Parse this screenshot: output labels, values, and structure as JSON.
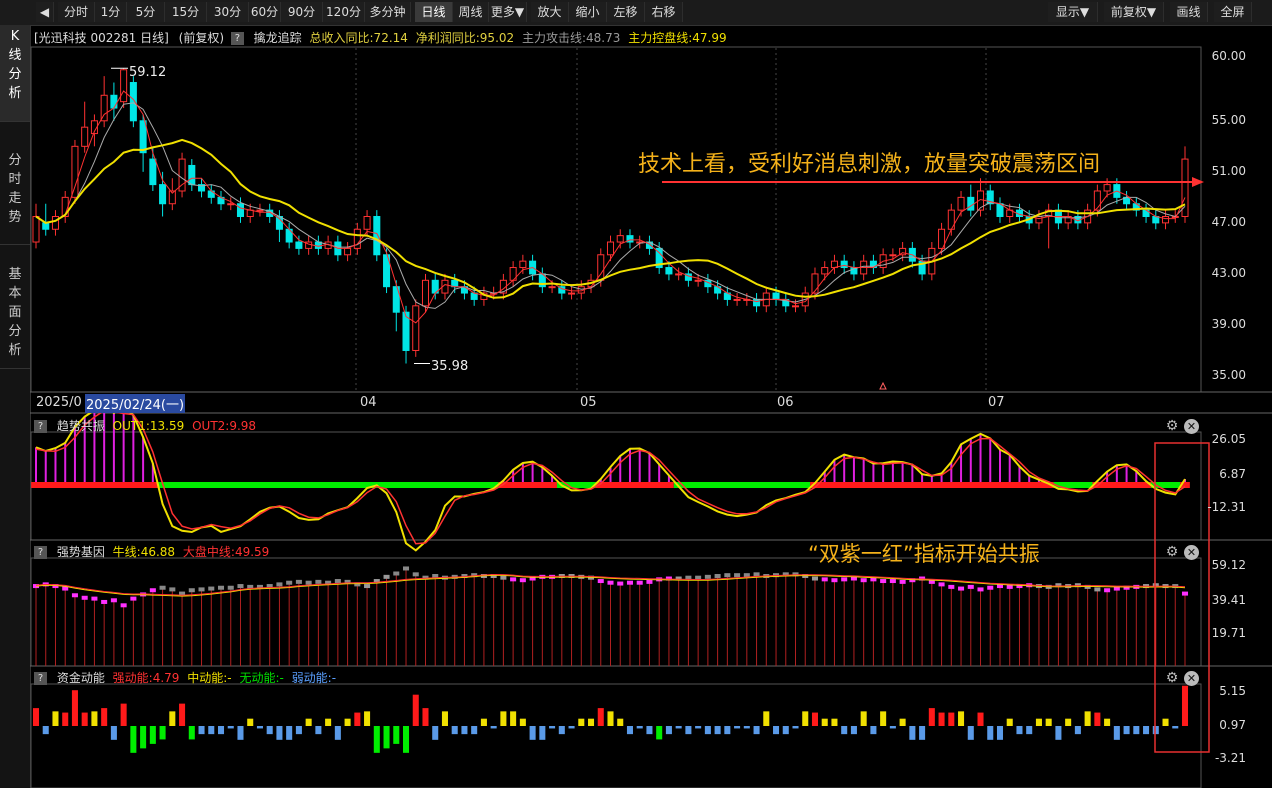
{
  "toolbar": {
    "items": [
      "分时",
      "1分",
      "5分",
      "15分",
      "30分",
      "60分",
      "90分",
      "120分",
      "多分钟",
      "日线",
      "周线",
      "更多▼",
      "放大",
      "缩小",
      "左移",
      "右移"
    ],
    "active": "日线",
    "right_items": [
      "显示▼",
      "前复权▼",
      "画线",
      "全屏"
    ]
  },
  "sidebar": {
    "tabs": [
      {
        "label": "K线分析",
        "active": true
      },
      {
        "label": "分时走势",
        "active": false
      },
      {
        "label": "基本面分析",
        "active": false
      }
    ]
  },
  "main_panel": {
    "title": "[光迅科技 002281 日线]",
    "adjust": "(前复权)",
    "indicator_name": "擒龙追踪",
    "metrics": [
      {
        "label": "总收入同比:72.14",
        "color": "#e0d040"
      },
      {
        "label": "净利润同比:95.02",
        "color": "#e0d040"
      },
      {
        "label": "主力攻击线:48.73",
        "color": "#9a9a9a"
      },
      {
        "label": "主力控盘线:47.99",
        "color": "#f0e000"
      }
    ],
    "y_ticks": [
      "60.00",
      "55.00",
      "51.00",
      "47.00",
      "43.00",
      "39.00",
      "35.00"
    ],
    "high_label": "59.12",
    "low_label": "35.98",
    "annotation": "技术上看，受利好消息刺激，放量突破震荡区间"
  },
  "date_axis": {
    "start": "2025/0",
    "cursor": "2025/02/24(一)",
    "months": [
      "04",
      "05",
      "06",
      "07"
    ]
  },
  "trend_panel": {
    "name": "趋势共振",
    "out1": "OUT1:13.59",
    "out2": "OUT2:9.98",
    "y_ticks": [
      "26.05",
      "6.87",
      "-12.31"
    ]
  },
  "gene_panel": {
    "name": "强势基因",
    "niu": "牛线:46.88",
    "dapan": "大盘中线:49.59",
    "y_ticks": [
      "59.12",
      "39.41",
      "19.71"
    ],
    "annotation": "“双紫一红”指标开始共振"
  },
  "fund_panel": {
    "name": "资金动能",
    "strong": "强动能:4.79",
    "mid": "中动能:-",
    "none": "无动能:-",
    "weak": "弱动能:-",
    "y_ticks": [
      "5.15",
      "0.97",
      "-3.21"
    ]
  },
  "colors": {
    "up": "#ff3232",
    "down": "#00e6e6",
    "ma_fast": "#ff3232",
    "ma_gray": "#aaaaaa",
    "ma_slow": "#f0e000",
    "purple": "#e020e0",
    "green": "#00ff00",
    "annotation": "#f5b21a"
  },
  "chart_data": [
    {
      "type": "candlestick",
      "title": "[光迅科技 002281 日线]",
      "ylim": [
        35,
        60
      ],
      "y_ticks": [
        60,
        55,
        51,
        47,
        43,
        39,
        35
      ],
      "note": "daily candles, approx O,C,H,L",
      "candles": [
        [
          45.5,
          47.5,
          48.5,
          45
        ],
        [
          47,
          46.5,
          48.5,
          46
        ],
        [
          46.5,
          47.5,
          48,
          46
        ],
        [
          47.5,
          49,
          49.5,
          47
        ],
        [
          49,
          53,
          53.5,
          48.5
        ],
        [
          53,
          54.5,
          56.5,
          52.5
        ],
        [
          54,
          55,
          55.5,
          53
        ],
        [
          55,
          57,
          58.5,
          54.5
        ],
        [
          57,
          56,
          58,
          55
        ],
        [
          56.5,
          59,
          59.12,
          56
        ],
        [
          58,
          55,
          58.5,
          54.5
        ],
        [
          55,
          52.5,
          55.5,
          51
        ],
        [
          52,
          50,
          53,
          49.5
        ],
        [
          50,
          48.5,
          51,
          47.5
        ],
        [
          48.5,
          49.5,
          50.5,
          48
        ],
        [
          49.5,
          52,
          52.5,
          49
        ],
        [
          51.5,
          50,
          52,
          49.5
        ],
        [
          50,
          49.5,
          50.5,
          49
        ],
        [
          49.5,
          49,
          50,
          48.5
        ],
        [
          49,
          48.5,
          49.5,
          48
        ],
        [
          48.5,
          48.5,
          49,
          48
        ],
        [
          48.5,
          47.5,
          49,
          47
        ],
        [
          47.5,
          48,
          48.5,
          47
        ],
        [
          48,
          48,
          48.5,
          47.5
        ],
        [
          48,
          47.5,
          48.5,
          47
        ],
        [
          47.5,
          46.5,
          48,
          45.5
        ],
        [
          46.5,
          45.5,
          47,
          45
        ],
        [
          45.5,
          45,
          46,
          44.5
        ],
        [
          45,
          45.5,
          46,
          44.5
        ],
        [
          45.5,
          45,
          46,
          44.5
        ],
        [
          45,
          45.5,
          46,
          44.5
        ],
        [
          45.5,
          44.5,
          46,
          44
        ],
        [
          44.5,
          45,
          45.5,
          44
        ],
        [
          45,
          46.5,
          47,
          44.5
        ],
        [
          46.5,
          47.5,
          48,
          46
        ],
        [
          47.5,
          44.5,
          48,
          44
        ],
        [
          44.5,
          42,
          45,
          41.5
        ],
        [
          42,
          40,
          42.5,
          38.5
        ],
        [
          40,
          37,
          40.5,
          35.98
        ],
        [
          37,
          40.5,
          41,
          36.5
        ],
        [
          40.5,
          42.5,
          43,
          40
        ],
        [
          42.5,
          41.5,
          43,
          41
        ],
        [
          41.5,
          42.5,
          43,
          41
        ],
        [
          42.5,
          42,
          43,
          41.5
        ],
        [
          42,
          41.5,
          42.5,
          41
        ],
        [
          41.5,
          41,
          42,
          40.5
        ],
        [
          41,
          41.5,
          42,
          40.5
        ],
        [
          41.5,
          41.5,
          42,
          41
        ],
        [
          41.5,
          42.5,
          43,
          41
        ],
        [
          42.5,
          43.5,
          44,
          42
        ],
        [
          43.5,
          44,
          44.5,
          43
        ],
        [
          44,
          43,
          44.5,
          42.5
        ],
        [
          43,
          42,
          43.5,
          41.5
        ],
        [
          42,
          42,
          42.5,
          41.5
        ],
        [
          42,
          41.5,
          42.5,
          41
        ],
        [
          41.5,
          41.5,
          42,
          41
        ],
        [
          41.5,
          42,
          42.5,
          41
        ],
        [
          42,
          42.5,
          43,
          41.5
        ],
        [
          42.5,
          44.5,
          45,
          42
        ],
        [
          44.5,
          45.5,
          46,
          44
        ],
        [
          45.5,
          46,
          46.5,
          45
        ],
        [
          46,
          45.5,
          46.5,
          45
        ],
        [
          45.5,
          45.5,
          46,
          45
        ],
        [
          45.5,
          45,
          46,
          44.5
        ],
        [
          45,
          43.5,
          45.5,
          43
        ],
        [
          43.5,
          43,
          44,
          42.5
        ],
        [
          43,
          43,
          43.5,
          42.5
        ],
        [
          43,
          42.5,
          43.5,
          42
        ],
        [
          42.5,
          42.5,
          43,
          42
        ],
        [
          42.5,
          42,
          43,
          41.5
        ],
        [
          42,
          41.5,
          42.5,
          41
        ],
        [
          41.5,
          41,
          42,
          40.5
        ],
        [
          41,
          41,
          41.5,
          40.5
        ],
        [
          41,
          41,
          41.5,
          40.5
        ],
        [
          41,
          40.5,
          41.5,
          40
        ],
        [
          40.5,
          41.5,
          42,
          40
        ],
        [
          41.5,
          41,
          42,
          40.5
        ],
        [
          41,
          40.5,
          41.5,
          40
        ],
        [
          40.5,
          40.5,
          41,
          40
        ],
        [
          40.5,
          41.5,
          42,
          40
        ],
        [
          41.5,
          43,
          43.5,
          41
        ],
        [
          43,
          43.5,
          44,
          42.5
        ],
        [
          43.5,
          44,
          44.5,
          43
        ],
        [
          44,
          43.5,
          44.5,
          43
        ],
        [
          43.5,
          43,
          44,
          42.5
        ],
        [
          43,
          44,
          44.5,
          42.5
        ],
        [
          44,
          43.5,
          44.5,
          43
        ],
        [
          43.5,
          44.5,
          45,
          43
        ],
        [
          44.5,
          44.5,
          45,
          44
        ],
        [
          44.5,
          45,
          45.5,
          44
        ],
        [
          45,
          44,
          45.5,
          43.5
        ],
        [
          44,
          43,
          44.5,
          42.5
        ],
        [
          43,
          45,
          45.5,
          42.5
        ],
        [
          45,
          46.5,
          47,
          44.5
        ],
        [
          46.5,
          48,
          48.5,
          46
        ],
        [
          48,
          49,
          49.5,
          47.5
        ],
        [
          49,
          48,
          50,
          47.5
        ],
        [
          48,
          49.5,
          50.5,
          47.5
        ],
        [
          49.5,
          48.5,
          50,
          48
        ],
        [
          48.5,
          47.5,
          49,
          47
        ],
        [
          47.5,
          48,
          48.5,
          47
        ],
        [
          48,
          47.5,
          48.5,
          47
        ],
        [
          47.5,
          47,
          48,
          46.5
        ],
        [
          47,
          47.5,
          48,
          46.5
        ],
        [
          47.5,
          48,
          48.5,
          45
        ],
        [
          48,
          47,
          48.5,
          46.5
        ],
        [
          47,
          47.5,
          48,
          46.5
        ],
        [
          47.5,
          47,
          48,
          46.5
        ],
        [
          47,
          48,
          48.5,
          46.5
        ],
        [
          48,
          49.5,
          50,
          47.5
        ],
        [
          49.5,
          50,
          50.5,
          49
        ],
        [
          50,
          49,
          50.5,
          48.5
        ],
        [
          49,
          48.5,
          49.5,
          48
        ],
        [
          48.5,
          48,
          49,
          47.5
        ],
        [
          48,
          47.5,
          48.5,
          47
        ],
        [
          47.5,
          47,
          48,
          46.5
        ],
        [
          47,
          47.5,
          48,
          46.5
        ],
        [
          47.5,
          47.5,
          48,
          47
        ],
        [
          47.5,
          52,
          53,
          47
        ]
      ]
    }
  ]
}
